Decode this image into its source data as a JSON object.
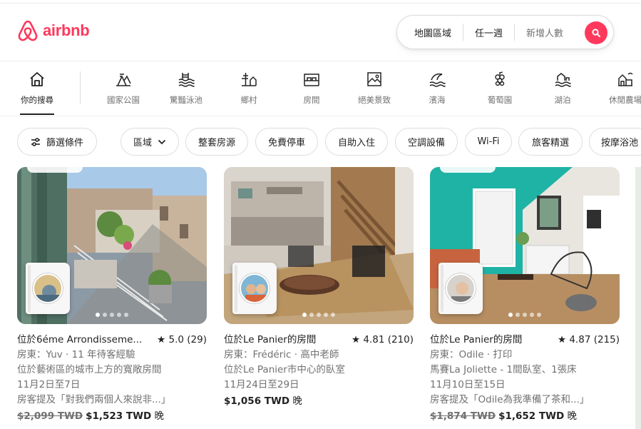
{
  "brand": {
    "name": "airbnb",
    "color": "#ff385c"
  },
  "search": {
    "where": "地圖區域",
    "when": "任一週",
    "guests": "新增人數",
    "button_icon": "search-icon"
  },
  "categories": [
    {
      "label": "你的搜尋",
      "icon": "home-icon",
      "active": true
    },
    {
      "label": "國家公園",
      "icon": "national-park-icon"
    },
    {
      "label": "驚豔泳池",
      "icon": "pool-icon"
    },
    {
      "label": "鄉村",
      "icon": "countryside-icon"
    },
    {
      "label": "房間",
      "icon": "room-icon"
    },
    {
      "label": "絕美景致",
      "icon": "view-icon"
    },
    {
      "label": "濱海",
      "icon": "beach-icon"
    },
    {
      "label": "葡萄園",
      "icon": "vineyard-icon"
    },
    {
      "label": "湖泊",
      "icon": "lake-icon"
    },
    {
      "label": "休閒農場",
      "icon": "farm-icon"
    }
  ],
  "filters": [
    {
      "label": "篩選條件",
      "icon": "filter-icon"
    },
    {
      "label": "區域",
      "icon": "chevron-down-icon"
    },
    {
      "label": "整套房源"
    },
    {
      "label": "免費停車"
    },
    {
      "label": "自助入住"
    },
    {
      "label": "空調設備"
    },
    {
      "label": "Wi-Fi"
    },
    {
      "label": "旅客精選"
    },
    {
      "label": "按摩浴池"
    }
  ],
  "listings": [
    {
      "title": "位於6éme Arrondisseme...",
      "rating": "★ 5.0 (29)",
      "host": "房東：Yuv · 11 年待客經驗",
      "desc": "位於藝術區的城市上方的寬敞房間",
      "dates": "11月2日至7日",
      "review": "房客提及「對我們兩個人來說非...」",
      "old_price": "$2,099 TWD",
      "price": "$1,523 TWD",
      "per": "晚"
    },
    {
      "title": "位於Le Panier的房間",
      "rating": "★ 4.81 (210)",
      "host": "房東：Frédéric · 高中老師",
      "desc": "位於Le Panier市中心的臥室",
      "dates": "11月24日至29日",
      "price": "$1,056 TWD",
      "per": "晚"
    },
    {
      "title": "位於Le Panier的房間",
      "rating": "★ 4.87 (215)",
      "host": "房東：Odile · 打印",
      "desc": "馬賽La Joliette - 1間臥室、1張床",
      "dates": "11月10日至15日",
      "review": "房客提及「Odile為我準備了茶和...」",
      "old_price": "$1,874 TWD",
      "price": "$1,652 TWD",
      "per": "晚"
    }
  ]
}
